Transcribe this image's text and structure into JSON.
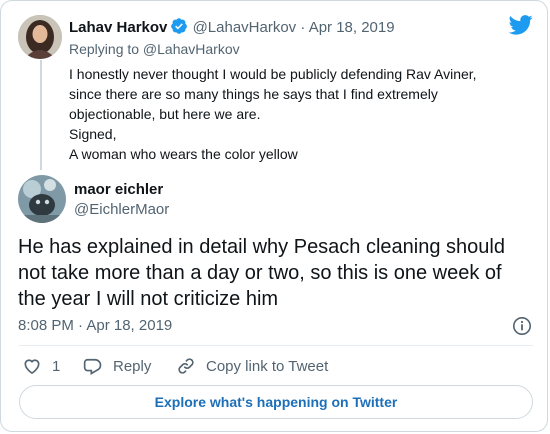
{
  "reply_tweet": {
    "author_name": "Lahav Harkov",
    "handle": "@LahavHarkov",
    "separator": "·",
    "date": "Apr 18, 2019",
    "replying_to": "Replying to @LahavHarkov",
    "lines": [
      "I honestly never thought I would be publicly defending Rav Aviner,",
      "since there are so many things he says that I find extremely",
      "objectionable, but here we are.",
      "Signed,",
      "A woman who wears the color yellow"
    ]
  },
  "main_tweet": {
    "author_name": "maor eichler",
    "handle": "@EichlerMaor",
    "text_lines": [
      "He has explained in detail why Pesach cleaning should",
      "not take more than a day or two, so this is one week of",
      "the year I will not criticize him"
    ],
    "timestamp": "8:08 PM · Apr 18, 2019"
  },
  "actions": {
    "like_count": "1",
    "reply_label": "Reply",
    "copy_link_label": "Copy link to Tweet"
  },
  "explore_label": "Explore what's happening on Twitter",
  "icons": {
    "brand": "twitter-bird-icon",
    "verified": "verified-badge-icon",
    "info": "info-icon",
    "like": "heart-icon",
    "reply": "reply-bubble-icon",
    "copy_link": "link-icon"
  },
  "colors": {
    "twitter_blue": "#1d9bf0",
    "link_blue": "#1d6fb8",
    "muted_text": "#536471",
    "border": "#cfd9de"
  }
}
